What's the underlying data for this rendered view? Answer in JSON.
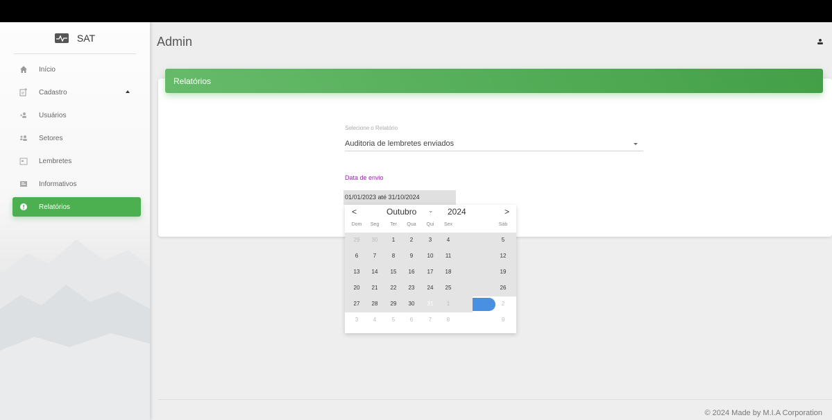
{
  "app": {
    "brand": "SAT",
    "page_title": "Admin"
  },
  "sidebar": {
    "items": [
      {
        "label": "Início",
        "icon": "home-icon"
      },
      {
        "label": "Cadastro",
        "icon": "add-document-icon"
      },
      {
        "label": "Usuários",
        "icon": "users-icon"
      },
      {
        "label": "Setores",
        "icon": "sectors-icon"
      },
      {
        "label": "Lembretes",
        "icon": "reminder-icon"
      },
      {
        "label": "Informativos",
        "icon": "info-card-icon"
      },
      {
        "label": "Relatórios",
        "icon": "report-icon"
      }
    ],
    "active_color": "#4caf50"
  },
  "card": {
    "title": "Relatórios",
    "header_color": "#4caf50"
  },
  "report_select": {
    "label": "Selecione o Relatório",
    "value": "Auditoria de lembretes enviados"
  },
  "date_filter": {
    "label": "Data de envio",
    "value": "01/01/2023 até 31/10/2024",
    "label_color": "#9c27b0"
  },
  "calendar": {
    "prev": "<",
    "next": ">",
    "month": "Outubro",
    "year": "2024",
    "weekdays": [
      "Dom",
      "Seg",
      "Ter",
      "Qua",
      "Qui",
      "Sex",
      "Sáb"
    ],
    "weeks": [
      [
        "29",
        "30",
        "1",
        "2",
        "3",
        "4",
        "5"
      ],
      [
        "6",
        "7",
        "8",
        "9",
        "10",
        "11",
        "12"
      ],
      [
        "13",
        "14",
        "15",
        "16",
        "17",
        "18",
        "19"
      ],
      [
        "20",
        "21",
        "22",
        "23",
        "24",
        "25",
        "26"
      ],
      [
        "27",
        "28",
        "29",
        "30",
        "31",
        "1",
        "2"
      ],
      [
        "3",
        "4",
        "5",
        "6",
        "7",
        "8",
        "9"
      ]
    ],
    "selected": "31",
    "selected_color": "#4a90e2"
  },
  "footer": {
    "text": "© 2024 Made by M.I.A Corporation"
  }
}
